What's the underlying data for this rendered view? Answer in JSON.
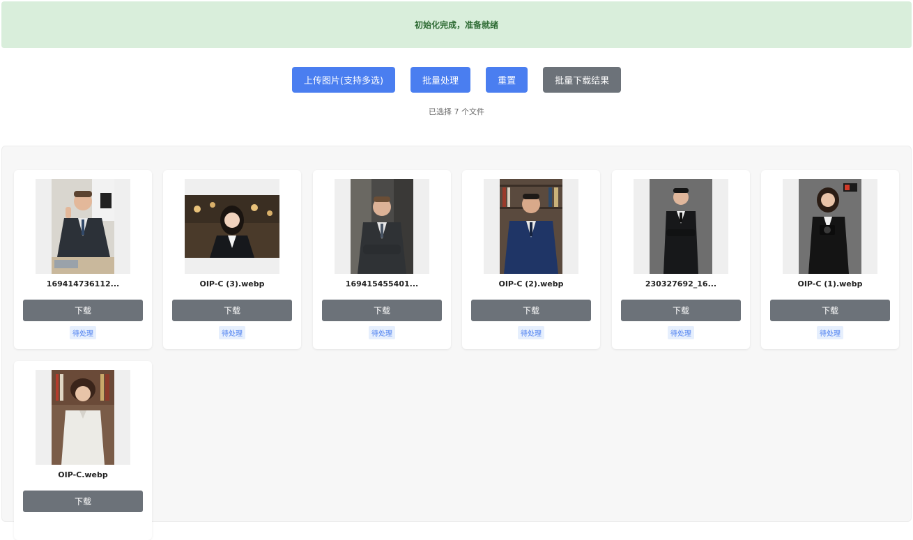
{
  "status": {
    "message": "初始化完成，准备就绪"
  },
  "toolbar": {
    "upload_label": "上传图片(支持多选)",
    "batch_process_label": "批量处理",
    "reset_label": "重置",
    "batch_download_label": "批量下载结果"
  },
  "selection": {
    "count_text": "已选择 7 个文件"
  },
  "files": [
    {
      "name": "169414736112...",
      "download_label": "下载",
      "status": "待处理"
    },
    {
      "name": "OIP-C (3).webp",
      "download_label": "下载",
      "status": "待处理"
    },
    {
      "name": "169415455401...",
      "download_label": "下载",
      "status": "待处理"
    },
    {
      "name": "OIP-C (2).webp",
      "download_label": "下载",
      "status": "待处理"
    },
    {
      "name": "230327692_16...",
      "download_label": "下载",
      "status": "待处理"
    },
    {
      "name": "OIP-C (1).webp",
      "download_label": "下载",
      "status": "待处理"
    },
    {
      "name": "OIP-C.webp",
      "download_label": "下载"
    }
  ],
  "colors": {
    "status_bg": "#d9eedb",
    "status_text": "#2e6b34",
    "primary": "#4a7ef0",
    "secondary": "#6c7279",
    "badge_bg": "#e6effd"
  }
}
